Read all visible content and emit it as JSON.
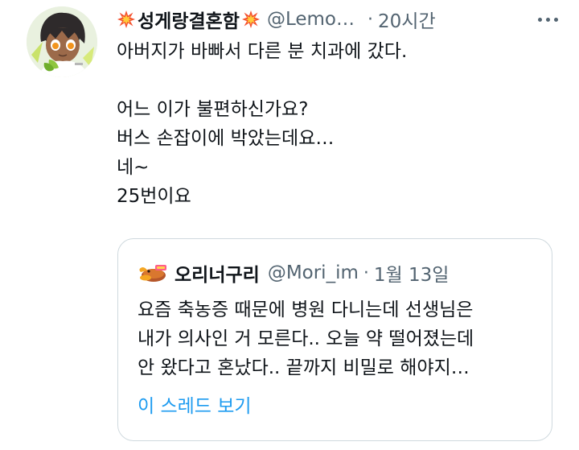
{
  "tweet": {
    "display_name": "성게랑결혼함",
    "handle": "@Lemo…",
    "separator": "·",
    "time": "20시간",
    "lines": [
      "아버지가 바빠서 다른 분 치과에 갔다.",
      "",
      "어느 이가 불편하신가요?",
      "버스 손잡이에 박았는데요…",
      "네~",
      "25번이요"
    ]
  },
  "quote": {
    "display_name": "오리너구리",
    "handle": "@Mori_im",
    "separator": "·",
    "date": "1월 13일",
    "lines": [
      "요즘 축농증 때문에 병원 다니는데 선생님은",
      "내가 의사인 거 모른다.. 오늘 약 떨어졌는데",
      "안 왔다고 혼났다.. 끝까지 비밀로 해야지…"
    ],
    "show_thread": "이 스레드 보기"
  },
  "icons": {
    "name_decoration": "collision-icon",
    "more": "more-horizontal-icon"
  },
  "colors": {
    "text": "#0f1419",
    "secondary": "#536471",
    "link": "#1d9bf0",
    "border": "#cfd9de"
  }
}
